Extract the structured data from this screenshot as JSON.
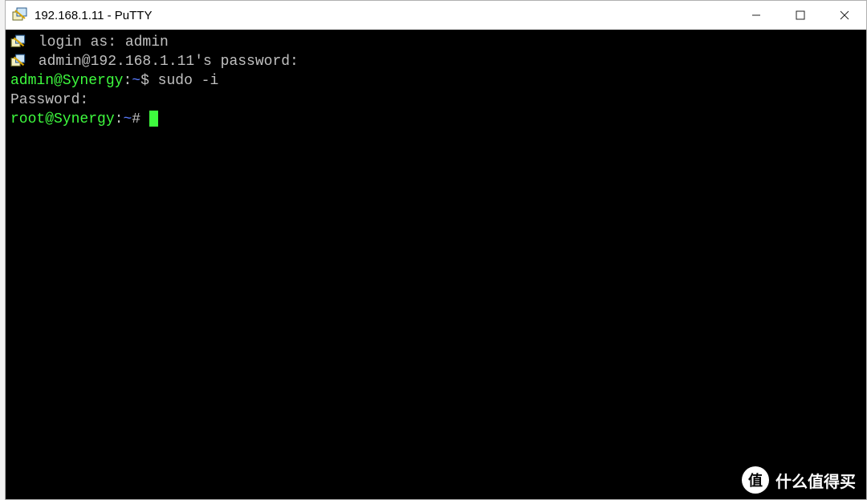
{
  "titlebar": {
    "title": "192.168.1.11 - PuTTY"
  },
  "terminal": {
    "lines": [
      {
        "prefixIcon": true,
        "segments": [
          {
            "cls": "col-default",
            "text": " login as: admin"
          }
        ]
      },
      {
        "prefixIcon": true,
        "segments": [
          {
            "cls": "col-default",
            "text": " admin@192.168.1.11's password:"
          }
        ]
      },
      {
        "prefixIcon": false,
        "segments": [
          {
            "cls": "col-green",
            "text": "admin@Synergy"
          },
          {
            "cls": "col-default",
            "text": ":"
          },
          {
            "cls": "col-blue",
            "text": "~"
          },
          {
            "cls": "col-default",
            "text": "$ sudo -i"
          }
        ]
      },
      {
        "prefixIcon": false,
        "segments": [
          {
            "cls": "col-default",
            "text": "Password:"
          }
        ]
      },
      {
        "prefixIcon": false,
        "cursor": true,
        "segments": [
          {
            "cls": "col-green",
            "text": "root@Synergy"
          },
          {
            "cls": "col-default",
            "text": ":"
          },
          {
            "cls": "col-blue",
            "text": "~"
          },
          {
            "cls": "col-default",
            "text": "# "
          }
        ]
      }
    ]
  },
  "watermark": {
    "badge": "值",
    "text": "什么值得买"
  }
}
